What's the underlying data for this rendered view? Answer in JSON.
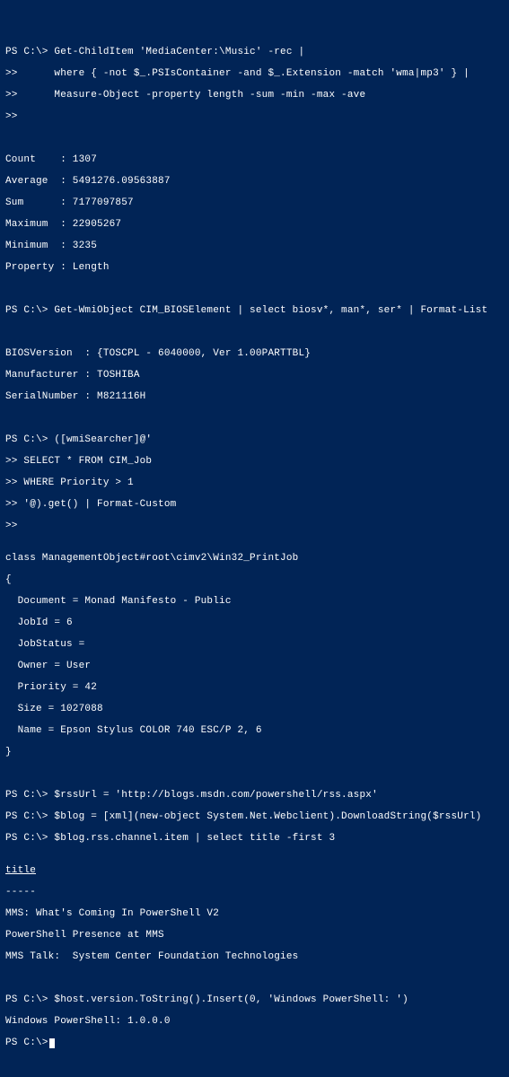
{
  "lines": {
    "l1": "PS C:\\> Get-ChildItem 'MediaCenter:\\Music' -rec |",
    "l2": ">>      where { -not $_.PSIsContainer -and $_.Extension -match 'wma|mp3' } |",
    "l3": ">>      Measure-Object -property length -sum -min -max -ave",
    "l4": ">>",
    "l5": "",
    "l6": "",
    "l7": "Count    : 1307",
    "l8": "Average  : 5491276.09563887",
    "l9": "Sum      : 7177097857",
    "l10": "Maximum  : 22905267",
    "l11": "Minimum  : 3235",
    "l12": "Property : Length",
    "l13": "",
    "l14": "",
    "l15": "PS C:\\> Get-WmiObject CIM_BIOSElement | select biosv*, man*, ser* | Format-List",
    "l16": "",
    "l17": "",
    "l18": "BIOSVersion  : {TOSCPL - 6040000, Ver 1.00PARTTBL}",
    "l19": "Manufacturer : TOSHIBA",
    "l20": "SerialNumber : M821116H",
    "l21": "",
    "l22": "",
    "l23": "PS C:\\> ([wmiSearcher]@'",
    "l24": ">> SELECT * FROM CIM_Job",
    "l25": ">> WHERE Priority > 1",
    "l26": ">> '@).get() | Format-Custom",
    "l27": ">>",
    "l28": "",
    "l29": "class ManagementObject#root\\cimv2\\Win32_PrintJob",
    "l30": "{",
    "l31": "  Document = Monad Manifesto - Public",
    "l32": "  JobId = 6",
    "l33": "  JobStatus =",
    "l34": "  Owner = User",
    "l35": "  Priority = 42",
    "l36": "  Size = 1027088",
    "l37": "  Name = Epson Stylus COLOR 740 ESC/P 2, 6",
    "l38": "}",
    "l39": "",
    "l40": "",
    "l41": "PS C:\\> $rssUrl = 'http://blogs.msdn.com/powershell/rss.aspx'",
    "l42": "PS C:\\> $blog = [xml](new-object System.Net.Webclient).DownloadString($rssUrl)",
    "l43": "PS C:\\> $blog.rss.channel.item | select title -first 3",
    "l44": "",
    "l45": "title",
    "l46": "-----",
    "l47": "MMS: What's Coming In PowerShell V2",
    "l48": "PowerShell Presence at MMS",
    "l49": "MMS Talk:  System Center Foundation Technologies",
    "l50": "",
    "l51": "",
    "l52": "PS C:\\> $host.version.ToString().Insert(0, 'Windows PowerShell: ')",
    "l53": "Windows PowerShell: 1.0.0.0",
    "l54": "PS C:\\>"
  }
}
